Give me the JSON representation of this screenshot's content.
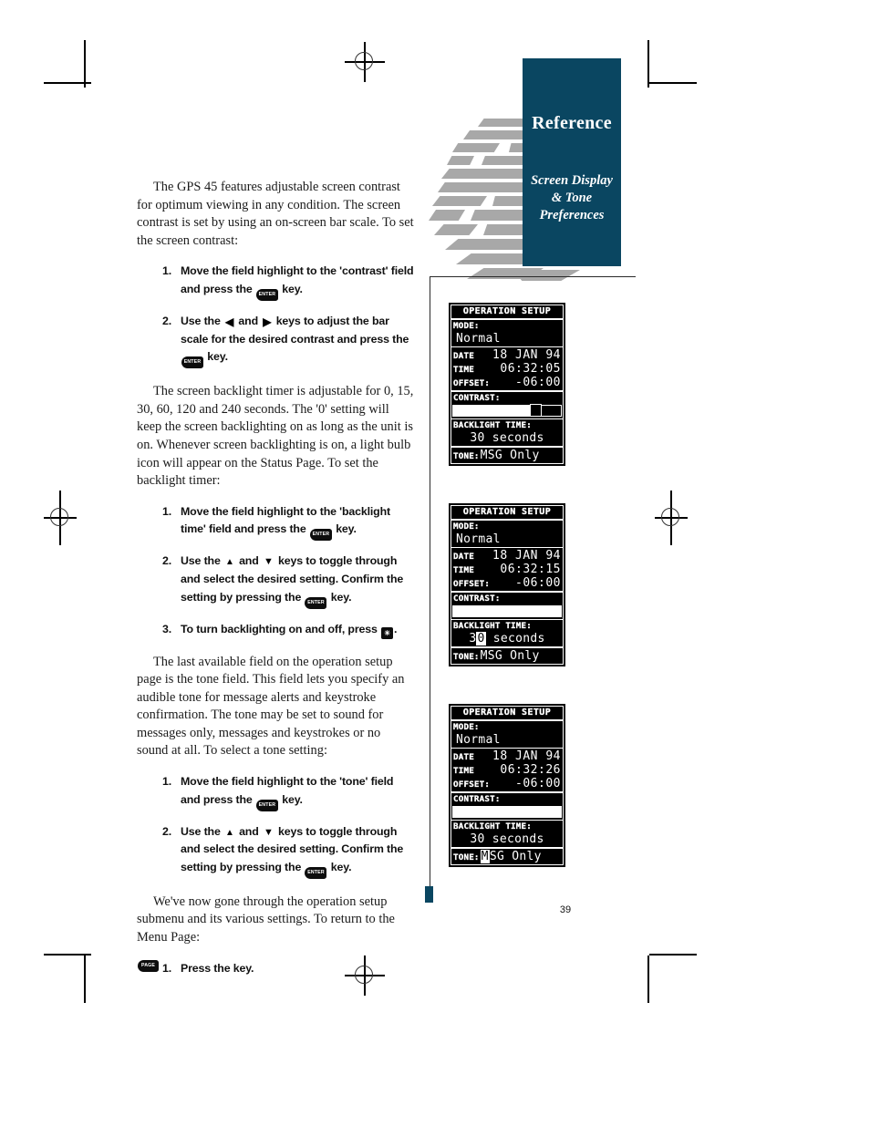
{
  "page": {
    "number": "39",
    "section_header": {
      "title": "Reference",
      "subtitle_line1": "Screen Display",
      "subtitle_line2": "& Tone",
      "subtitle_line3": "Preferences",
      "accent_color": "#0a4661",
      "globe_color": "#a8a8a8"
    }
  },
  "body": {
    "para1": "The GPS 45 features adjustable screen contrast for optimum viewing in any condition. The screen contrast is set by using an on-screen bar scale. To set the screen contrast:",
    "para2": "The screen backlight timer is adjustable for 0, 15, 30, 60, 120 and 240 seconds. The '0' setting will keep the screen backlighting on as long as the unit is on. Whenever screen backlighting is on, a light bulb icon will appear on the Status Page. To set the backlight timer:",
    "para3": "The last available field on the operation setup page is the tone field. This field lets you specify an audible tone for message alerts and keystroke confirmation. The tone may be set to sound for messages only, messages and keystrokes or no sound at all. To select a tone setting:",
    "para4": "We've now gone through the operation setup submenu and its various settings. To return to the Menu Page:"
  },
  "steps": {
    "contrast": [
      {
        "num": "1.",
        "text_a": "Move the field highlight to the 'contrast' field and press the",
        "key": "ENTER",
        "text_b": "key."
      },
      {
        "num": "2.",
        "text_a": "Use the",
        "arrow_left": "◀",
        "text_mid": "and",
        "arrow_right": "▶",
        "text_b": "keys to adjust the bar scale for the desired contrast and press the",
        "key": "ENTER",
        "text_c": "key."
      }
    ],
    "backlight": [
      {
        "num": "1.",
        "text_a": "Move the field highlight to the 'backlight time' field and press the",
        "key": "ENTER",
        "text_b": "key."
      },
      {
        "num": "2.",
        "text_a": "Use the",
        "arrow_up": "▲",
        "text_mid": "and",
        "arrow_down": "▼",
        "text_b": "keys to toggle through and select the desired setting. Confirm the setting by pressing the",
        "key": "ENTER",
        "text_c": "key."
      },
      {
        "num": "3.",
        "text_a": "To turn backlighting on and off, press",
        "key": "LAMP",
        "text_b": "."
      }
    ],
    "tone": [
      {
        "num": "1.",
        "text_a": "Move the field highlight to the 'tone' field and press the",
        "key": "ENTER",
        "text_b": "key."
      },
      {
        "num": "2.",
        "text_a": "Use the",
        "arrow_up": "▲",
        "text_mid": "and",
        "arrow_down": "▼",
        "text_b": "keys to toggle through and select the desired setting. Confirm the setting by pressing the",
        "key": "ENTER",
        "text_c": "key."
      }
    ],
    "menu": [
      {
        "num": "1.",
        "text_a": "Press the",
        "key": "PAGE",
        "text_b": "key."
      }
    ]
  },
  "keys": {
    "enter_label": "ENTER",
    "page_label": "PAGE",
    "lamp_glyph": "☀"
  },
  "screens": [
    {
      "title": "OPERATION SETUP",
      "mode_label": "MODE:",
      "mode_value": "Normal",
      "date_label": "DATE",
      "date_value": "18 JAN 94",
      "time_label": "TIME",
      "time_value": "06:32:05",
      "offset_label": "OFFSET:",
      "offset_value": "-06:00",
      "contrast_label": "CONTRAST:",
      "contrast_fill_pct": 82,
      "contrast_knob_visible": true,
      "backlight_label": "BACKLIGHT TIME:",
      "backlight_value": "30 seconds",
      "backlight_highlight": "",
      "tone_label": "TONE:",
      "tone_value": "MSG Only",
      "tone_highlight": ""
    },
    {
      "title": "OPERATION SETUP",
      "mode_label": "MODE:",
      "mode_value": "Normal",
      "date_label": "DATE",
      "date_value": "18 JAN 94",
      "time_label": "TIME",
      "time_value": "06:32:15",
      "offset_label": "OFFSET:",
      "offset_value": "-06:00",
      "contrast_label": "CONTRAST:",
      "contrast_fill_pct": 100,
      "contrast_knob_visible": false,
      "backlight_label": "BACKLIGHT TIME:",
      "backlight_value": "30 seconds",
      "backlight_highlight": "0",
      "tone_label": "TONE:",
      "tone_value": "MSG Only",
      "tone_highlight": ""
    },
    {
      "title": "OPERATION SETUP",
      "mode_label": "MODE:",
      "mode_value": "Normal",
      "date_label": "DATE",
      "date_value": "18 JAN 94",
      "time_label": "TIME",
      "time_value": "06:32:26",
      "offset_label": "OFFSET:",
      "offset_value": "-06:00",
      "contrast_label": "CONTRAST:",
      "contrast_fill_pct": 100,
      "contrast_knob_visible": false,
      "backlight_label": "BACKLIGHT TIME:",
      "backlight_value": "30 seconds",
      "backlight_highlight": "",
      "tone_label": "TONE:",
      "tone_value": "MSG Only",
      "tone_highlight": "M"
    }
  ]
}
